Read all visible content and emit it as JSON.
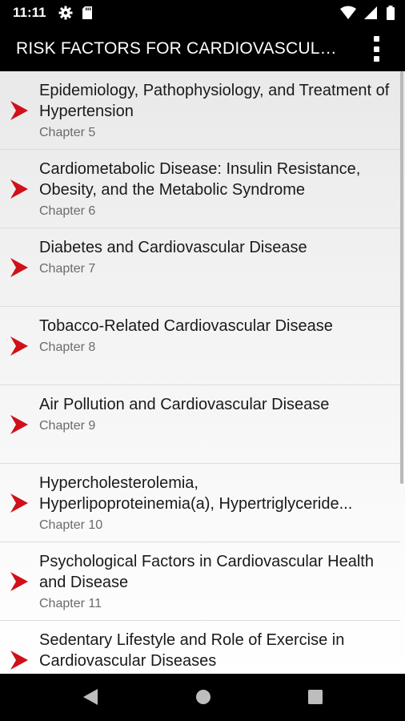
{
  "status_bar": {
    "time": "11:11"
  },
  "app_bar": {
    "title": "RISK FACTORS FOR CARDIOVASCULAR..."
  },
  "chapters": [
    {
      "title": "Epidemiology, Pathophysiology, and Treatment of Hypertension",
      "chapter": "Chapter 5"
    },
    {
      "title": "Cardiometabolic Disease: Insulin Resistance, Obesity, and the Metabolic Syndrome",
      "chapter": "Chapter 6"
    },
    {
      "title": "Diabetes and Cardiovascular Disease",
      "chapter": "Chapter 7"
    },
    {
      "title": "Tobacco-Related Cardiovascular Disease",
      "chapter": "Chapter 8"
    },
    {
      "title": "Air Pollution and Cardiovascular Disease",
      "chapter": "Chapter 9"
    },
    {
      "title_line1": "Hypercholesterolemia,",
      "title_line2": "Hyperlipoproteinemia(a), Hypertriglyceride...",
      "chapter": "Chapter 10"
    },
    {
      "title": "Psychological Factors in Cardiovascular Health and Disease",
      "chapter": "Chapter 11"
    },
    {
      "title": "Sedentary Lifestyle and Role of Exercise in Cardiovascular Diseases",
      "chapter": ""
    }
  ],
  "colors": {
    "arrow": "#d0101a",
    "app_bar": "#000000",
    "text": "#1a1a1a",
    "subtext": "#6b6b6b"
  }
}
